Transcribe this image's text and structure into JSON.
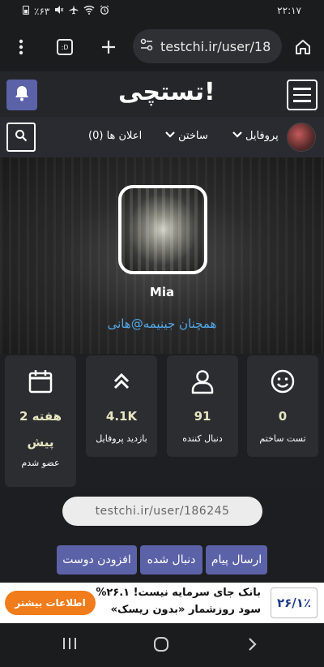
{
  "status_bar": {
    "time": "۲۲:۱۷",
    "battery": "٪۶۳",
    "icons": [
      "battery-icon",
      "mute-icon",
      "airplane-icon",
      "wifi-icon",
      "alarm-icon"
    ]
  },
  "browser": {
    "url": "testchi.ir/user/18",
    "tab_count": ":D",
    "icons": [
      "menu-dots-icon",
      "tabs-icon",
      "plus-icon",
      "site-settings-icon",
      "home-icon"
    ]
  },
  "site": {
    "logo": "تستچی!",
    "accent_color": "#5b62a8"
  },
  "nav": {
    "profile": "پروفایل",
    "build": "ساختن",
    "notifications": "اعلان ها (0)"
  },
  "profile": {
    "username": "Mia",
    "subtitle": "همچنان جینیمه@هانی"
  },
  "stats": [
    {
      "icon": "smiley-icon",
      "value": "0",
      "label": "تست ساختم"
    },
    {
      "icon": "user-icon",
      "value": "91",
      "label": "دنبال کننده"
    },
    {
      "icon": "double-chevron-up-icon",
      "value": "4.1K",
      "label": "بازدید پروفایل"
    },
    {
      "icon": "calendar-icon",
      "value_line1": "2 هفته",
      "value_line2": "پیش",
      "label": "عضو شدم"
    }
  ],
  "profile_url": "testchi.ir/user/186245",
  "actions": {
    "send_message": "ارسال پیام",
    "followed": "دنبال شده",
    "add_friend": "افزودن دوست"
  },
  "ad": {
    "badge": "۲۶/۱٪",
    "line1": "بانک جای سرمایه نیست! ۲۶.۱%",
    "line2": "سود روزشمار «بدون ریسک»",
    "cta": "اطلاعات بیشتر"
  }
}
